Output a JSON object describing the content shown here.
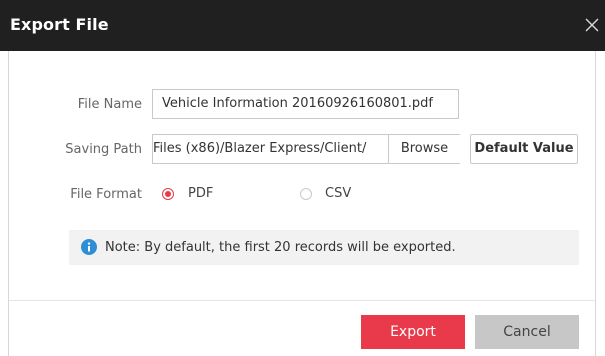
{
  "dialog": {
    "title": "Export File",
    "close_icon": "close-icon"
  },
  "form": {
    "file_name_label": "File Name",
    "file_name_value": "Vehicle Information 20160926160801.pdf",
    "saving_path_label": "Saving Path",
    "saving_path_value": "Files (x86)/Blazer Express/Client/",
    "browse_label": "Browse",
    "default_value_label": "Default Value",
    "file_format_label": "File Format",
    "formats": [
      {
        "label": "PDF",
        "selected": true
      },
      {
        "label": "CSV",
        "selected": false
      }
    ]
  },
  "note": {
    "icon": "info-icon",
    "text": "Note: By default, the first 20 records will be exported."
  },
  "footer": {
    "export_label": "Export",
    "cancel_label": "Cancel"
  },
  "colors": {
    "accent": "#e83a4a",
    "titlebar": "#202020",
    "info_icon": "#2e8fd6",
    "cancel_bg": "#c7c7c7"
  }
}
